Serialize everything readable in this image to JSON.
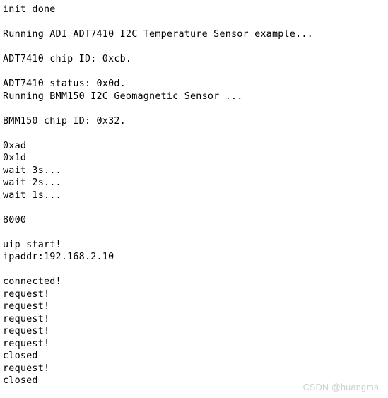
{
  "app": {
    "type": "serial-console-log",
    "background_color": "#ffffff",
    "text_color": "#000000"
  },
  "console": {
    "lines": [
      "init done",
      "",
      "Running ADI ADT7410 I2C Temperature Sensor example...",
      "",
      "ADT7410 chip ID: 0xcb.",
      "",
      "ADT7410 status: 0x0d.",
      "Running BMM150 I2C Geomagnetic Sensor ...",
      "",
      "BMM150 chip ID: 0x32.",
      "",
      "0xad",
      "0x1d",
      "wait 3s...",
      "wait 2s...",
      "wait 1s...",
      "",
      "8000",
      "",
      "uip start!",
      "ipaddr:192.168.2.10",
      "",
      "connected!",
      "request!",
      "request!",
      "request!",
      "request!",
      "request!",
      "closed",
      "request!",
      "closed"
    ]
  },
  "watermark": {
    "text": "CSDN @huangma.",
    "color": "#cfcfcf"
  }
}
